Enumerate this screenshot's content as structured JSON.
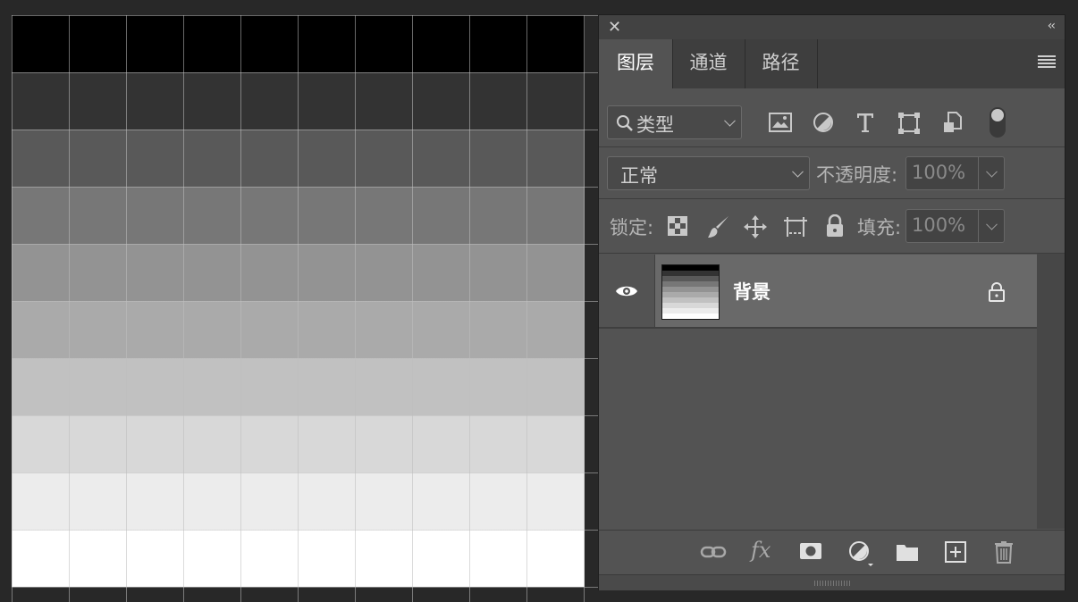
{
  "canvas": {
    "bands": [
      "#000000",
      "#333333",
      "#595959",
      "#777777",
      "#939393",
      "#aaaaaa",
      "#c1c1c1",
      "#d8d8d8",
      "#ececec",
      "#ffffff"
    ]
  },
  "panel": {
    "tabs": [
      {
        "label": "图层",
        "active": true
      },
      {
        "label": "通道",
        "active": false
      },
      {
        "label": "路径",
        "active": false
      }
    ],
    "filter": {
      "kind_label": "类型"
    },
    "blend": {
      "mode": "正常",
      "opacity_label": "不透明度:",
      "opacity_value": "100%"
    },
    "lock": {
      "label": "锁定:",
      "fill_label": "填充:",
      "fill_value": "100%"
    },
    "layers": [
      {
        "name": "背景",
        "visible": true,
        "locked": true
      }
    ]
  },
  "icons": {
    "close": "close-icon",
    "collapse": "double-chevron-left-icon",
    "menu": "hamburger-menu-icon",
    "search": "search-icon",
    "filter_image": "image-filter-icon",
    "filter_adjust": "adjustment-filter-icon",
    "filter_type": "type-filter-icon",
    "filter_shape": "shape-filter-icon",
    "filter_smart": "smart-object-filter-icon",
    "toggle": "filter-toggle-icon",
    "lock_pixels": "checkerboard-icon",
    "lock_brush": "brush-icon",
    "lock_move": "move-icon",
    "lock_artboard": "artboard-icon",
    "lock_all": "padlock-icon",
    "eye": "eye-icon",
    "link": "link-icon",
    "fx": "fx-icon",
    "mask": "mask-icon",
    "adjust": "adjustment-layer-icon",
    "folder": "folder-icon",
    "new_layer": "new-layer-icon",
    "trash": "trash-icon"
  }
}
